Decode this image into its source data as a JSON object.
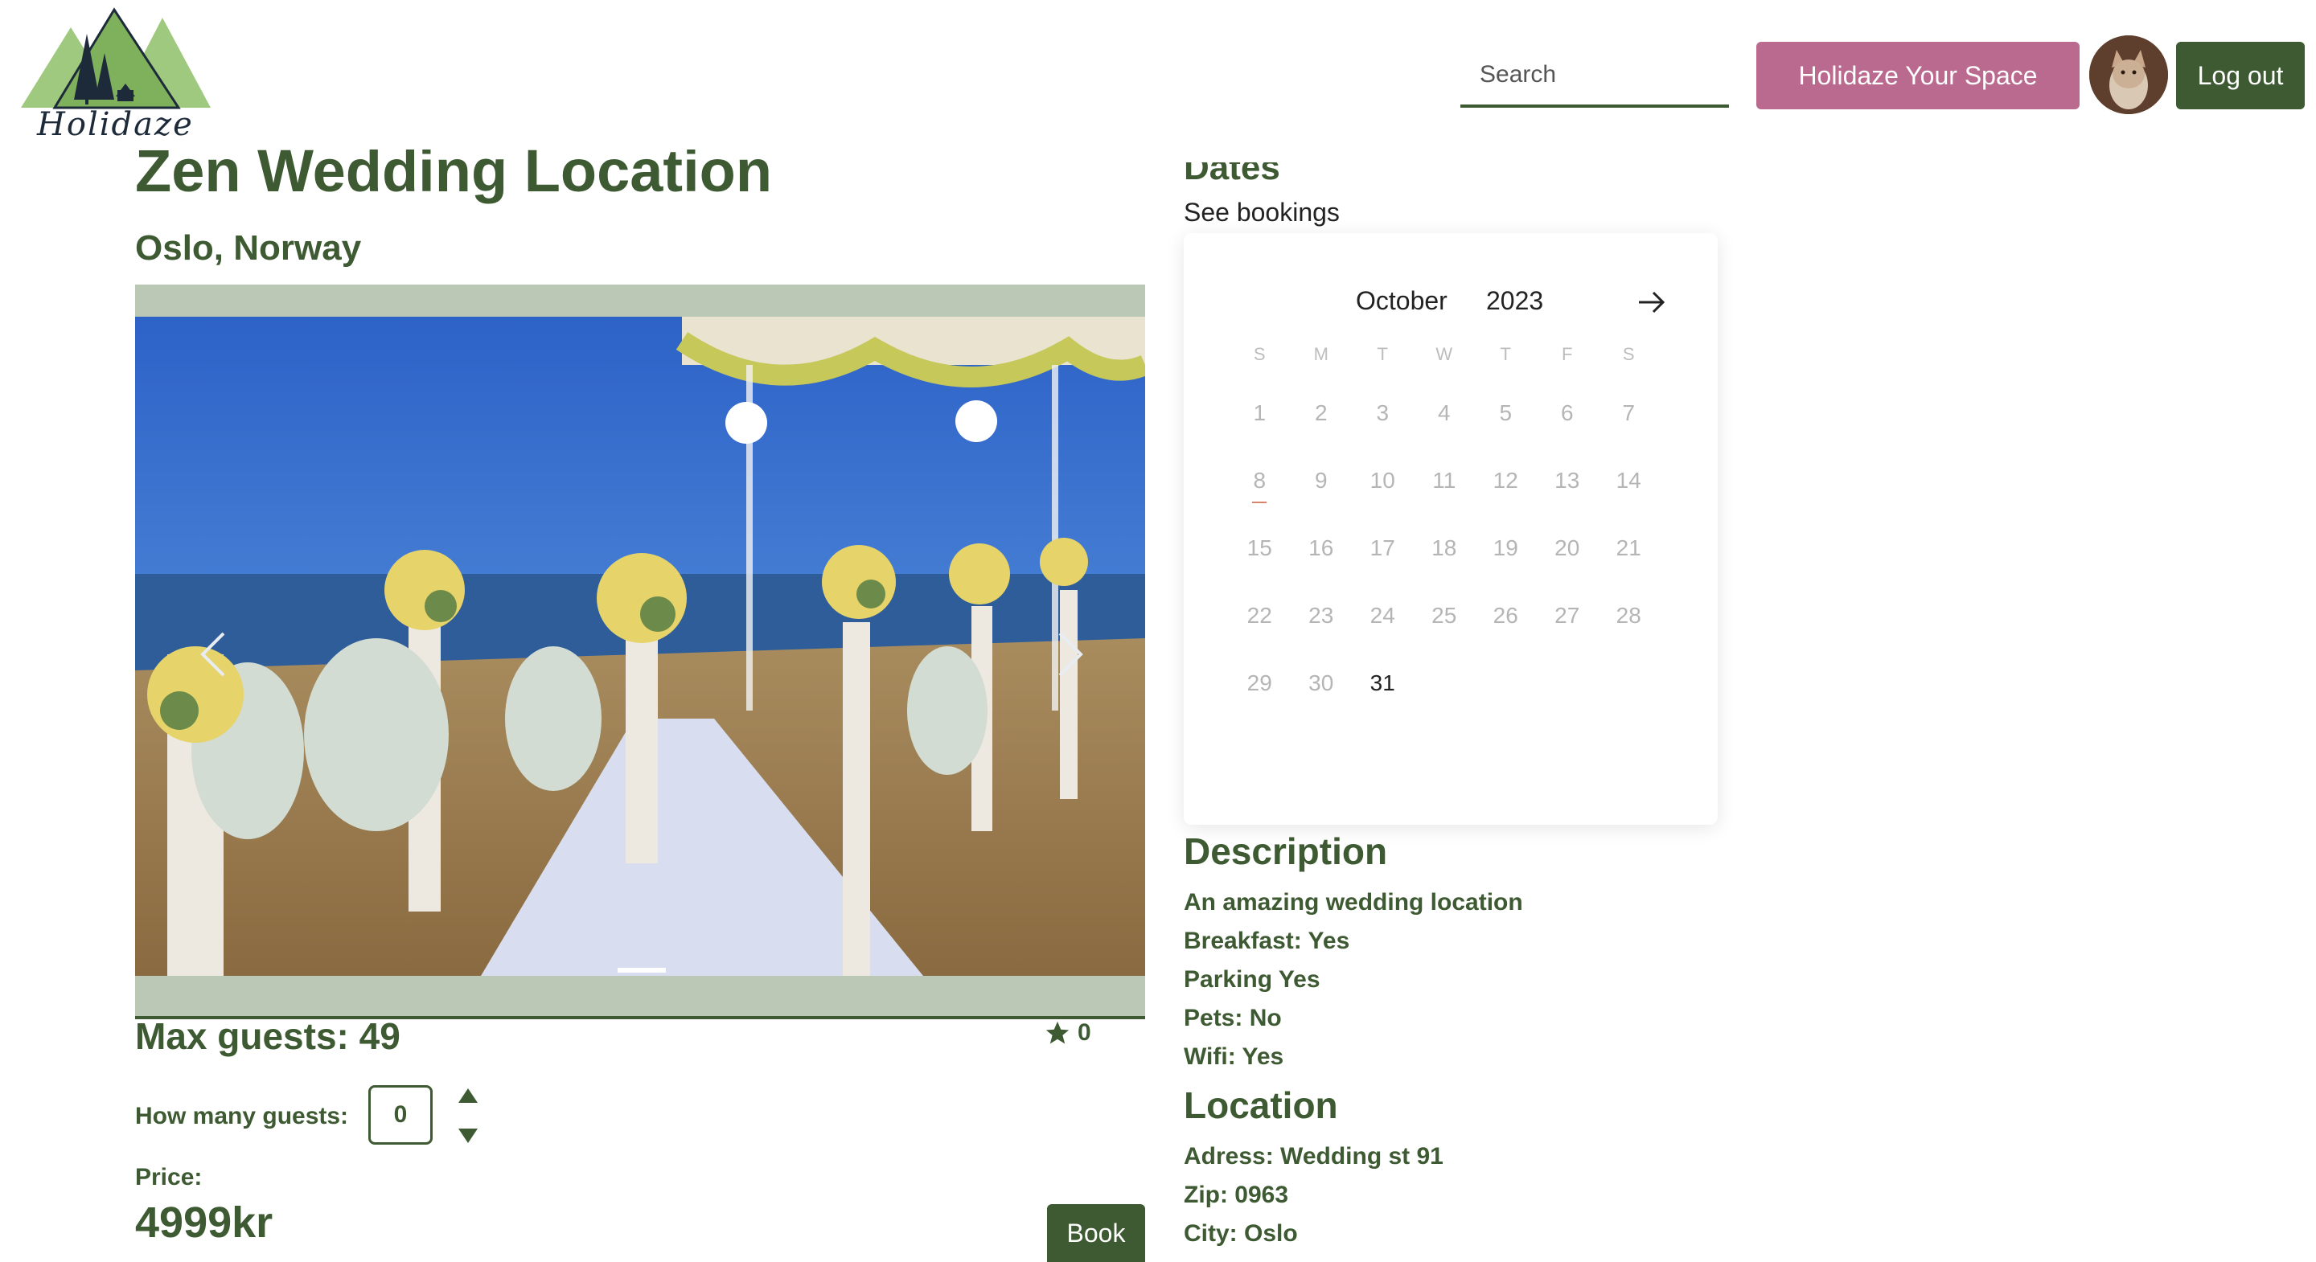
{
  "header": {
    "logo_text": "Holidaze",
    "search_placeholder": "Search",
    "host_button": "Holidaze Your Space",
    "logout_button": "Log out"
  },
  "venue": {
    "title": "Zen Wedding Location",
    "location": "Oslo, Norway",
    "max_guests": "Max guests: 49",
    "rating": "0",
    "guests_label": "How many guests:",
    "guests_value": "0",
    "price_label": "Price:",
    "price": "4999kr",
    "book_button": "Book"
  },
  "dates": {
    "heading": "Dates",
    "see_bookings": "See bookings",
    "month": "October",
    "year": "2023",
    "weekdays": [
      "S",
      "M",
      "T",
      "W",
      "T",
      "F",
      "S"
    ],
    "weeks": [
      [
        "1",
        "2",
        "3",
        "4",
        "5",
        "6",
        "7"
      ],
      [
        "8",
        "9",
        "10",
        "11",
        "12",
        "13",
        "14"
      ],
      [
        "15",
        "16",
        "17",
        "18",
        "19",
        "20",
        "21"
      ],
      [
        "22",
        "23",
        "24",
        "25",
        "26",
        "27",
        "28"
      ],
      [
        "29",
        "30",
        "31",
        "",
        "",
        "",
        ""
      ]
    ],
    "today": "8",
    "available": [
      "31"
    ]
  },
  "description": {
    "heading": "Description",
    "lines": [
      "An amazing wedding location",
      "Breakfast: Yes",
      "Parking Yes",
      "Pets: No",
      "Wifi: Yes"
    ]
  },
  "location": {
    "heading": "Location",
    "lines": [
      "Adress: Wedding st 91",
      "Zip: 0963",
      "City: Oslo"
    ]
  },
  "colors": {
    "brand_green": "#3d5a32",
    "host_pink": "#b96a8e",
    "carousel_bg": "#bac8b5"
  }
}
